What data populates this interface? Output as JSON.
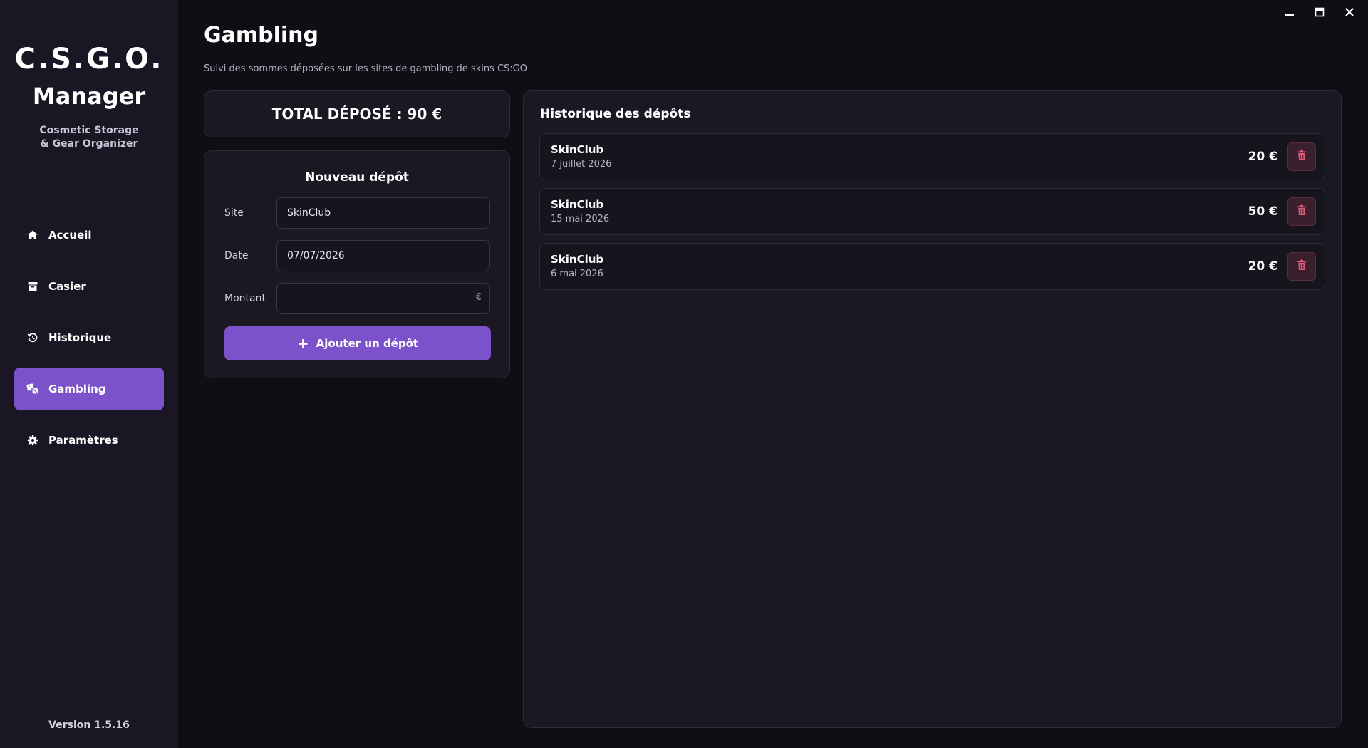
{
  "brand": {
    "line1": "C.S.G.O.",
    "line2": "Manager",
    "tagline1": "Cosmetic Storage",
    "tagline2": "& Gear Organizer"
  },
  "nav": [
    {
      "label": "Accueil",
      "icon": "home-icon",
      "active": false
    },
    {
      "label": "Casier",
      "icon": "archive-icon",
      "active": false
    },
    {
      "label": "Historique",
      "icon": "history-icon",
      "active": false
    },
    {
      "label": "Gambling",
      "icon": "dice-icon",
      "active": true
    },
    {
      "label": "Paramètres",
      "icon": "gear-icon",
      "active": false
    }
  ],
  "version": "Version 1.5.16",
  "page": {
    "title": "Gambling",
    "subtitle": "Suivi des sommes déposées sur les sites de gambling de skins CS:GO"
  },
  "total": {
    "text": "TOTAL DÉPOSÉ : 90 €"
  },
  "form": {
    "title": "Nouveau dépôt",
    "site_label": "Site",
    "site_value": "SkinClub",
    "date_label": "Date",
    "date_value": "07/07/2026",
    "amount_label": "Montant",
    "amount_value": "",
    "amount_suffix": "€",
    "submit_label": "Ajouter un dépôt"
  },
  "history": {
    "title": "Historique des dépôts",
    "items": [
      {
        "site": "SkinClub",
        "date": "7 juillet 2026",
        "amount": "20 €"
      },
      {
        "site": "SkinClub",
        "date": "15 mai 2026",
        "amount": "50 €"
      },
      {
        "site": "SkinClub",
        "date": "6 mai 2026",
        "amount": "20 €"
      }
    ]
  },
  "colors": {
    "accent": "#7b52c9",
    "sidebar": "#1a1624",
    "background": "#0f0e14",
    "card": "#1a1823",
    "delete": "#e05a7a"
  }
}
